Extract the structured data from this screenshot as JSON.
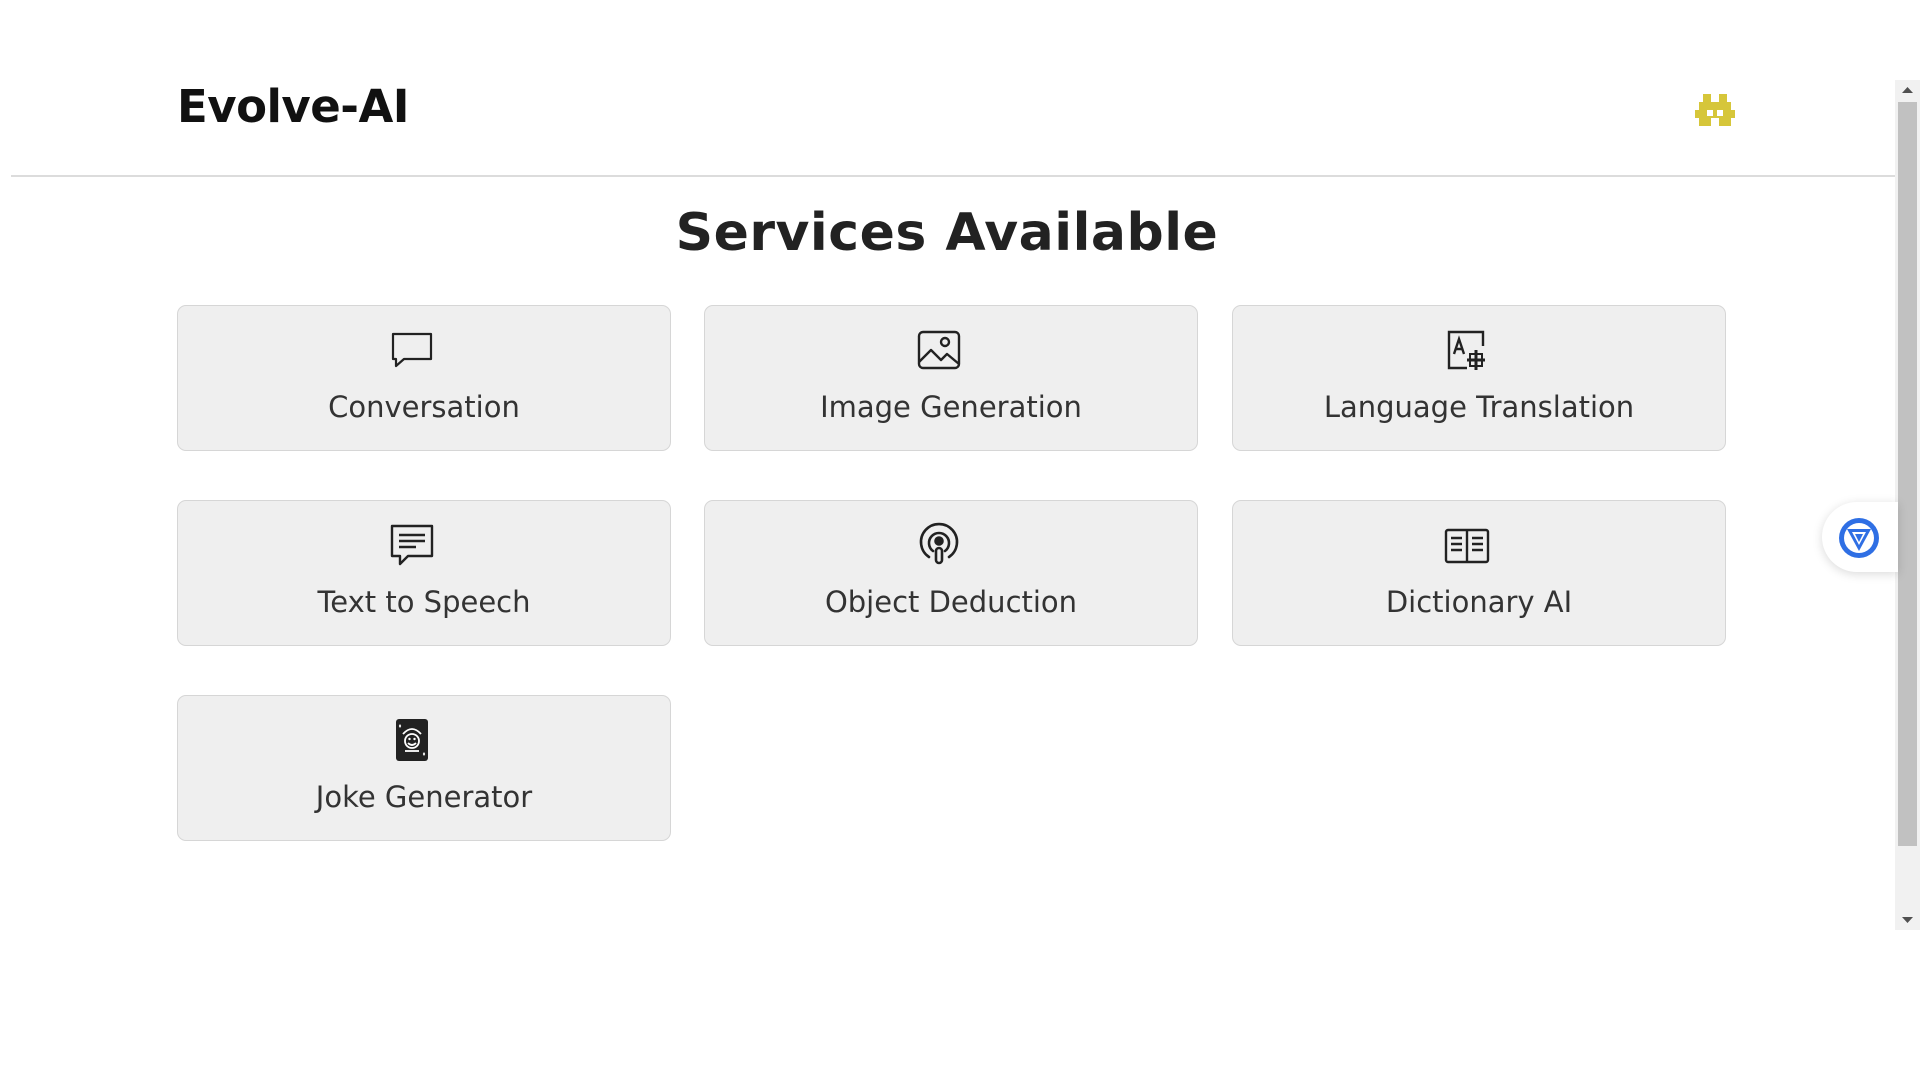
{
  "header": {
    "logo_text": "Evolve-AI",
    "avatar_icon": "user-avatar-icon",
    "avatar_color": "#d6c63a"
  },
  "main": {
    "title": "Services Available",
    "services": [
      {
        "label": "Conversation",
        "icon": "chat-bubble-icon"
      },
      {
        "label": "Image Generation",
        "icon": "image-icon"
      },
      {
        "label": "Language Translation",
        "icon": "translate-icon"
      },
      {
        "label": "Text to Speech",
        "icon": "message-text-icon"
      },
      {
        "label": "Object Deduction",
        "icon": "podcast-icon"
      },
      {
        "label": "Dictionary AI",
        "icon": "open-book-icon"
      },
      {
        "label": "Joke Generator",
        "icon": "joker-card-icon"
      }
    ]
  },
  "colors": {
    "card_bg": "#efefef",
    "card_border": "#d6d6d6",
    "widget_blue": "#2f6fe4"
  }
}
